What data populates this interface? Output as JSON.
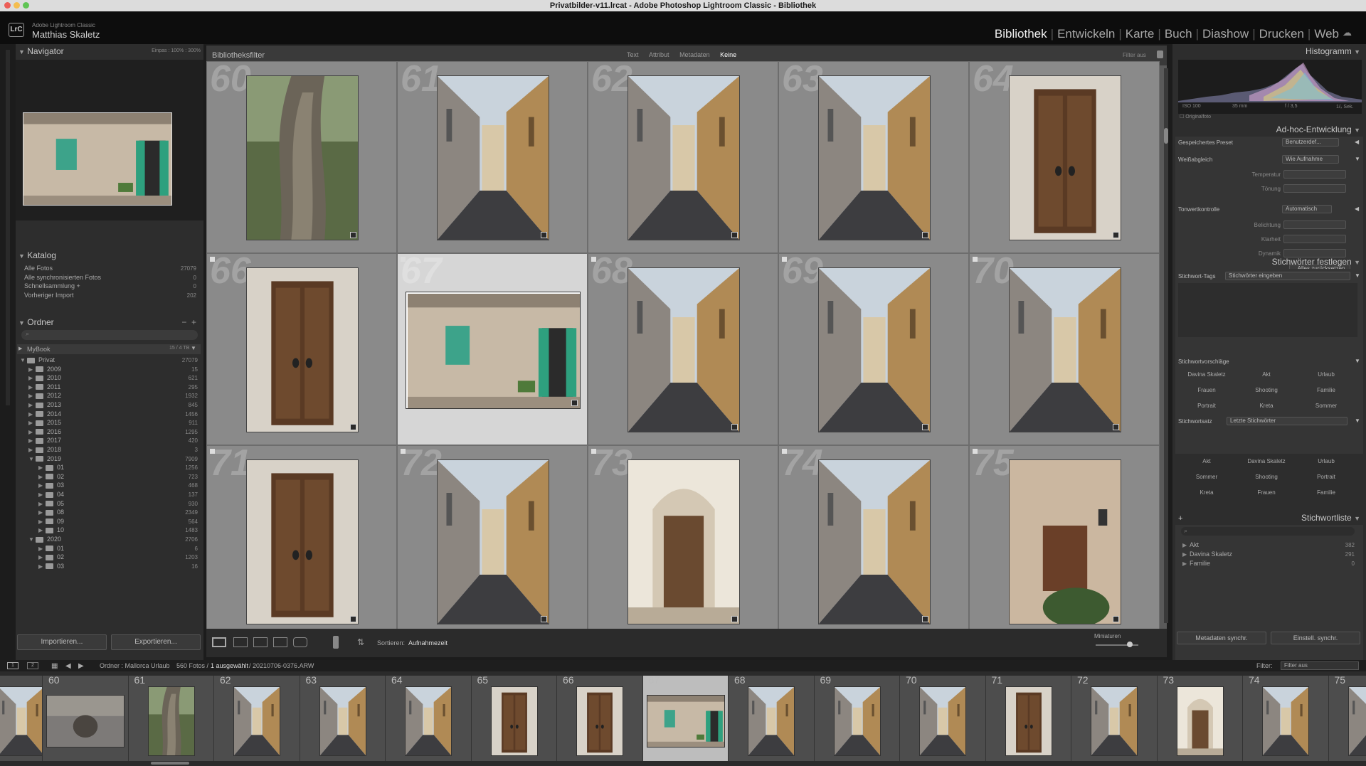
{
  "window": {
    "title": "Privatbilder-v11.lrcat - Adobe Photoshop Lightroom Classic - Bibliothek"
  },
  "identity": {
    "logo": "LrC",
    "app": "Adobe Lightroom Classic",
    "user": "Matthias Skaletz"
  },
  "modules": [
    {
      "label": "Bibliothek",
      "active": true
    },
    {
      "label": "Entwickeln"
    },
    {
      "label": "Karte"
    },
    {
      "label": "Buch"
    },
    {
      "label": "Diashow"
    },
    {
      "label": "Drucken"
    },
    {
      "label": "Web"
    }
  ],
  "navigator": {
    "title": "Navigator",
    "zoom": [
      "Einpas",
      "100%",
      "300%"
    ]
  },
  "catalog": {
    "title": "Katalog",
    "items": [
      {
        "label": "Alle Fotos",
        "count": "27079"
      },
      {
        "label": "Alle synchronisierten Fotos",
        "count": "0"
      },
      {
        "label": "Schnellsammlung +",
        "count": "0"
      },
      {
        "label": "Vorheriger Import",
        "count": "202"
      }
    ]
  },
  "folders": {
    "title": "Ordner",
    "volume": {
      "label": "MyBook",
      "info": "15 / 4 TB"
    },
    "root": {
      "label": "Privat",
      "count": "27079"
    },
    "years": [
      {
        "label": "2009",
        "count": "15"
      },
      {
        "label": "2010",
        "count": "621"
      },
      {
        "label": "2011",
        "count": "295"
      },
      {
        "label": "2012",
        "count": "1932"
      },
      {
        "label": "2013",
        "count": "845"
      },
      {
        "label": "2014",
        "count": "1456"
      },
      {
        "label": "2015",
        "count": "911"
      },
      {
        "label": "2016",
        "count": "1295"
      },
      {
        "label": "2017",
        "count": "420"
      },
      {
        "label": "2018",
        "count": "3"
      },
      {
        "label": "2019",
        "count": "7909",
        "open": true
      },
      {
        "label": "01",
        "count": "1256",
        "sub": true
      },
      {
        "label": "02",
        "count": "723",
        "sub": true
      },
      {
        "label": "03",
        "count": "468",
        "sub": true
      },
      {
        "label": "04",
        "count": "137",
        "sub": true
      },
      {
        "label": "05",
        "count": "930",
        "sub": true
      },
      {
        "label": "08",
        "count": "2349",
        "sub": true
      },
      {
        "label": "09",
        "count": "564",
        "sub": true
      },
      {
        "label": "10",
        "count": "1483",
        "sub": true
      },
      {
        "label": "2020",
        "count": "2706",
        "open": true
      },
      {
        "label": "01",
        "count": "6",
        "sub": true
      },
      {
        "label": "02",
        "count": "1203",
        "sub": true
      },
      {
        "label": "03",
        "count": "16",
        "sub": true
      }
    ]
  },
  "left_buttons": {
    "import": "Importieren...",
    "export": "Exportieren..."
  },
  "filterbar": {
    "title": "Bibliotheksfilter",
    "tabs": [
      "Text",
      "Attribut",
      "Metadaten",
      "Keine"
    ],
    "active_tab": "Keine",
    "preset": "Filter aus"
  },
  "grid": {
    "cells": [
      {
        "num": "60",
        "kind": "tree"
      },
      {
        "num": "61",
        "kind": "street"
      },
      {
        "num": "62",
        "kind": "street"
      },
      {
        "num": "63",
        "kind": "street"
      },
      {
        "num": "64",
        "kind": "door"
      },
      {
        "num": "66",
        "kind": "door"
      },
      {
        "num": "67",
        "kind": "wall",
        "selected": true
      },
      {
        "num": "68",
        "kind": "street"
      },
      {
        "num": "69",
        "kind": "street"
      },
      {
        "num": "70",
        "kind": "street"
      },
      {
        "num": "71",
        "kind": "door"
      },
      {
        "num": "72",
        "kind": "street"
      },
      {
        "num": "73",
        "kind": "arch"
      },
      {
        "num": "74",
        "kind": "street"
      },
      {
        "num": "75",
        "kind": "sign"
      }
    ]
  },
  "toolbar": {
    "sort_label": "Sortieren:",
    "sort_value": "Aufnahmezeit",
    "thumb_label": "Miniaturen"
  },
  "histogram": {
    "title": "Histogramm",
    "iso": "ISO 100",
    "focal": "35 mm",
    "aperture": "f / 3,5",
    "shutter": "1/ₛ Sek.",
    "original": "Originalfoto"
  },
  "quickdevelop": {
    "title": "Ad-hoc-Entwicklung",
    "preset_label": "Gespeichertes Preset",
    "preset_value": "Benutzerdef...",
    "wb_label": "Weißabgleich",
    "wb_value": "Wie Aufnahme",
    "temp": "Temperatur",
    "tint": "Tönung",
    "tone_label": "Tonwertkontrolle",
    "tone_value": "Automatisch",
    "exposure": "Belichtung",
    "clarity": "Klarheit",
    "vibrance": "Dynamik",
    "reset": "Alles zurücksetzen"
  },
  "keywording": {
    "title": "Stichwörter festlegen",
    "tags_label": "Stichwort-Tags",
    "tags_value": "Stichwörter eingeben",
    "suggest_title": "Stichwortvorschläge",
    "suggestions": [
      "Davina Skaletz",
      "Akt",
      "Urlaub",
      "Frauen",
      "Shooting",
      "Familie",
      "Portrait",
      "Kreta",
      "Sommer"
    ],
    "set_label": "Stichwortsatz",
    "set_value": "Letzte Stichwörter",
    "set_items": [
      "Akt",
      "Davina Skaletz",
      "Urlaub",
      "Sommer",
      "Shooting",
      "Portrait",
      "Kreta",
      "Frauen",
      "Familie"
    ]
  },
  "keywordlist": {
    "title": "Stichwortliste",
    "items": [
      {
        "label": "Akt",
        "count": "382"
      },
      {
        "label": "Davina Skaletz",
        "count": "291"
      },
      {
        "label": "Familie",
        "count": "0"
      }
    ]
  },
  "right_buttons": {
    "sync_meta": "Metadaten synchr.",
    "sync_settings": "Einstell. synchr."
  },
  "filmbar": {
    "source": "Ordner : Mallorca Urlaub",
    "count": "560 Fotos /",
    "selected": "1 ausgewählt",
    "file": "/ 20210706-0376.ARW",
    "filter_label": "Filter:",
    "filter_value": "Filter aus",
    "pages": [
      "1",
      "2"
    ]
  },
  "filmstrip": {
    "cells": [
      {
        "num": "",
        "kind": "street"
      },
      {
        "num": "60",
        "kind": "people"
      },
      {
        "num": "61",
        "kind": "tree"
      },
      {
        "num": "62",
        "kind": "street"
      },
      {
        "num": "63",
        "kind": "street"
      },
      {
        "num": "64",
        "kind": "street"
      },
      {
        "num": "65",
        "kind": "door"
      },
      {
        "num": "66",
        "kind": "door"
      },
      {
        "num": "67",
        "kind": "wall",
        "selected": true
      },
      {
        "num": "68",
        "kind": "street"
      },
      {
        "num": "69",
        "kind": "street"
      },
      {
        "num": "70",
        "kind": "street"
      },
      {
        "num": "71",
        "kind": "door"
      },
      {
        "num": "72",
        "kind": "street"
      },
      {
        "num": "73",
        "kind": "arch"
      },
      {
        "num": "74",
        "kind": "street"
      },
      {
        "num": "75",
        "kind": "street"
      }
    ]
  },
  "colors": {
    "accent": "#e8e8e8",
    "panel": "#2d2d2d",
    "grid": "#8a8a8a",
    "selected": "#d6d6d6"
  }
}
